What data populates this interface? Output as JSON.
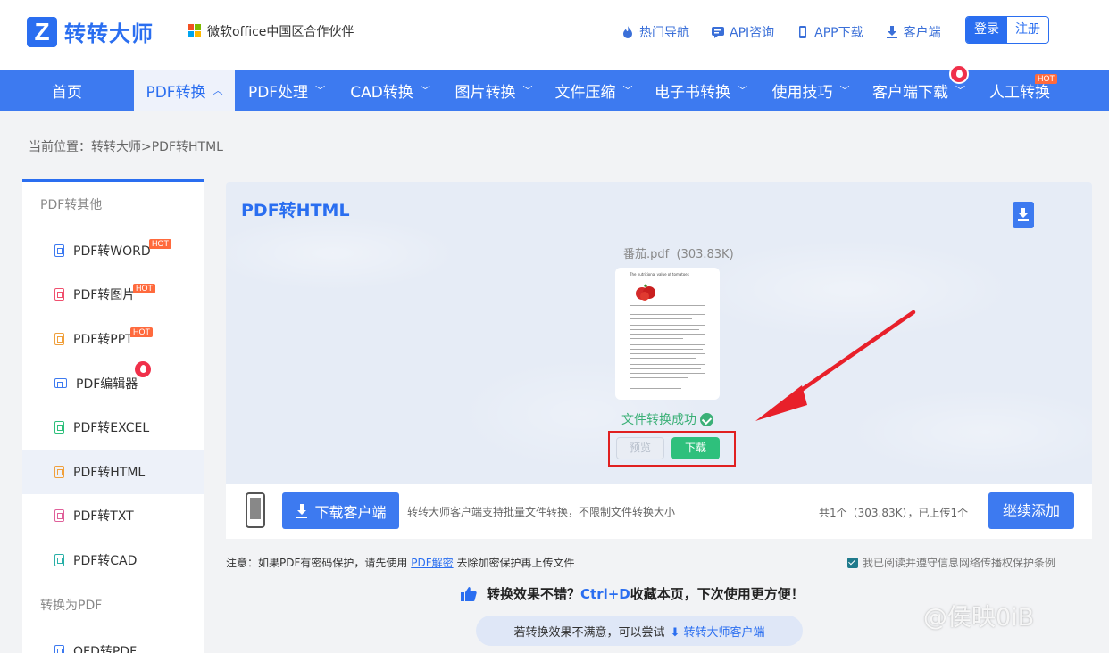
{
  "header": {
    "logo_text": "转转大师",
    "partner_text": "微软office中国区合作伙伴",
    "links": [
      {
        "label": "热门导航",
        "icon": "fire-icon"
      },
      {
        "label": "API咨询",
        "icon": "chat-icon"
      },
      {
        "label": "APP下载",
        "icon": "phone-icon"
      },
      {
        "label": "客户端",
        "icon": "download-icon"
      }
    ],
    "login_label": "登录",
    "register_label": "注册"
  },
  "nav": {
    "items": [
      {
        "label": "首页"
      },
      {
        "label": "PDF转换",
        "active": true
      },
      {
        "label": "PDF处理"
      },
      {
        "label": "CAD转换"
      },
      {
        "label": "图片转换"
      },
      {
        "label": "文件压缩"
      },
      {
        "label": "电子书转换"
      },
      {
        "label": "使用技巧"
      },
      {
        "label": "客户端下载"
      },
      {
        "label": "人工转换",
        "badge": "HOT"
      }
    ]
  },
  "breadcrumb": "当前位置：转转大师>PDF转HTML",
  "sidebar": {
    "group1": "PDF转其他",
    "items": [
      {
        "label": "PDF转WORD",
        "badge": "HOT",
        "color": "#3d7af0"
      },
      {
        "label": "PDF转图片",
        "badge": "HOT",
        "color": "#f0506e"
      },
      {
        "label": "PDF转PPT",
        "badge": "HOT",
        "color": "#f0a03c"
      },
      {
        "label": "PDF编辑器",
        "color": "#3d7af0"
      },
      {
        "label": "PDF转EXCEL",
        "color": "#2ec07c"
      },
      {
        "label": "PDF转HTML",
        "color": "#f0a03c",
        "active": true
      },
      {
        "label": "PDF转TXT",
        "color": "#e0609a"
      },
      {
        "label": "PDF转CAD",
        "color": "#2ab0a8"
      }
    ],
    "group2": "转换为PDF",
    "items2": [
      {
        "label": "OFD转PDF",
        "color": "#3d7af0"
      }
    ]
  },
  "main": {
    "title": "PDF转HTML",
    "file_name": "番茄.pdf",
    "file_size": "(303.83K)",
    "doc_title": "The nutritional value of tomatoes",
    "status": "文件转换成功",
    "preview_label": "预览",
    "download_label": "下载"
  },
  "actionbar": {
    "client_button": "下载客户端",
    "client_note": "转转大师客户端支持批量文件转换，不限制文件转换大小",
    "summary": "共1个（303.83K），已上传1个",
    "add_button": "继续添加"
  },
  "notice": {
    "prefix": "注意：如果PDF有密码保护，请先使用",
    "link": "PDF解密",
    "suffix": "去除加密保护再上传文件"
  },
  "agreement": "我已阅读并遵守信息网络传播权保护条例",
  "tip": {
    "prefix": "转换效果不错？",
    "key": "Ctrl+D",
    "suffix": "收藏本页，下次使用更方便！"
  },
  "retry": {
    "prefix": "若转换效果不满意，可以尝试",
    "link": "转转大师客户端"
  },
  "watermark": "@侯映0iB",
  "colors": {
    "brand": "#2a6ef0",
    "nav": "#3d7af0",
    "success": "#2ec07c",
    "highlight": "#e02020"
  }
}
